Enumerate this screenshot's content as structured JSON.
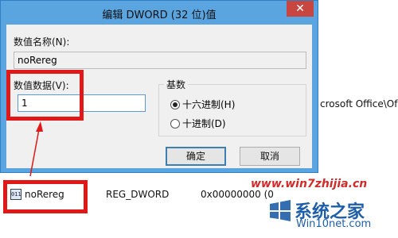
{
  "dialog": {
    "title": "编辑 DWORD (32 位)值",
    "close_label": "✕",
    "value_name_label": "数值名称(N):",
    "value_name": "noRereg",
    "value_data_label": "数值数据(V):",
    "value_data": "1",
    "base_label": "基数",
    "base_options": [
      "十六进制(H)",
      "十进制(D)"
    ],
    "base_selected": "十六进制(H)",
    "ok_label": "确定",
    "cancel_label": "取消"
  },
  "background": {
    "path_fragment": "crosoft Office\\Of",
    "row": {
      "name": "noRereg",
      "type": "REG_DWORD",
      "data": "0x00000000 (0"
    }
  },
  "watermark": {
    "site": "www.win7zhijia.cn",
    "brand": "系统之家",
    "sub": "Win10net.com"
  },
  "colors": {
    "highlight_box": "#e01818",
    "title_bar": "#5aa4e0",
    "close_button": "#c7463f"
  },
  "icons": {
    "row_icon": "dword-value-icon",
    "arrow": "red-arrow"
  }
}
